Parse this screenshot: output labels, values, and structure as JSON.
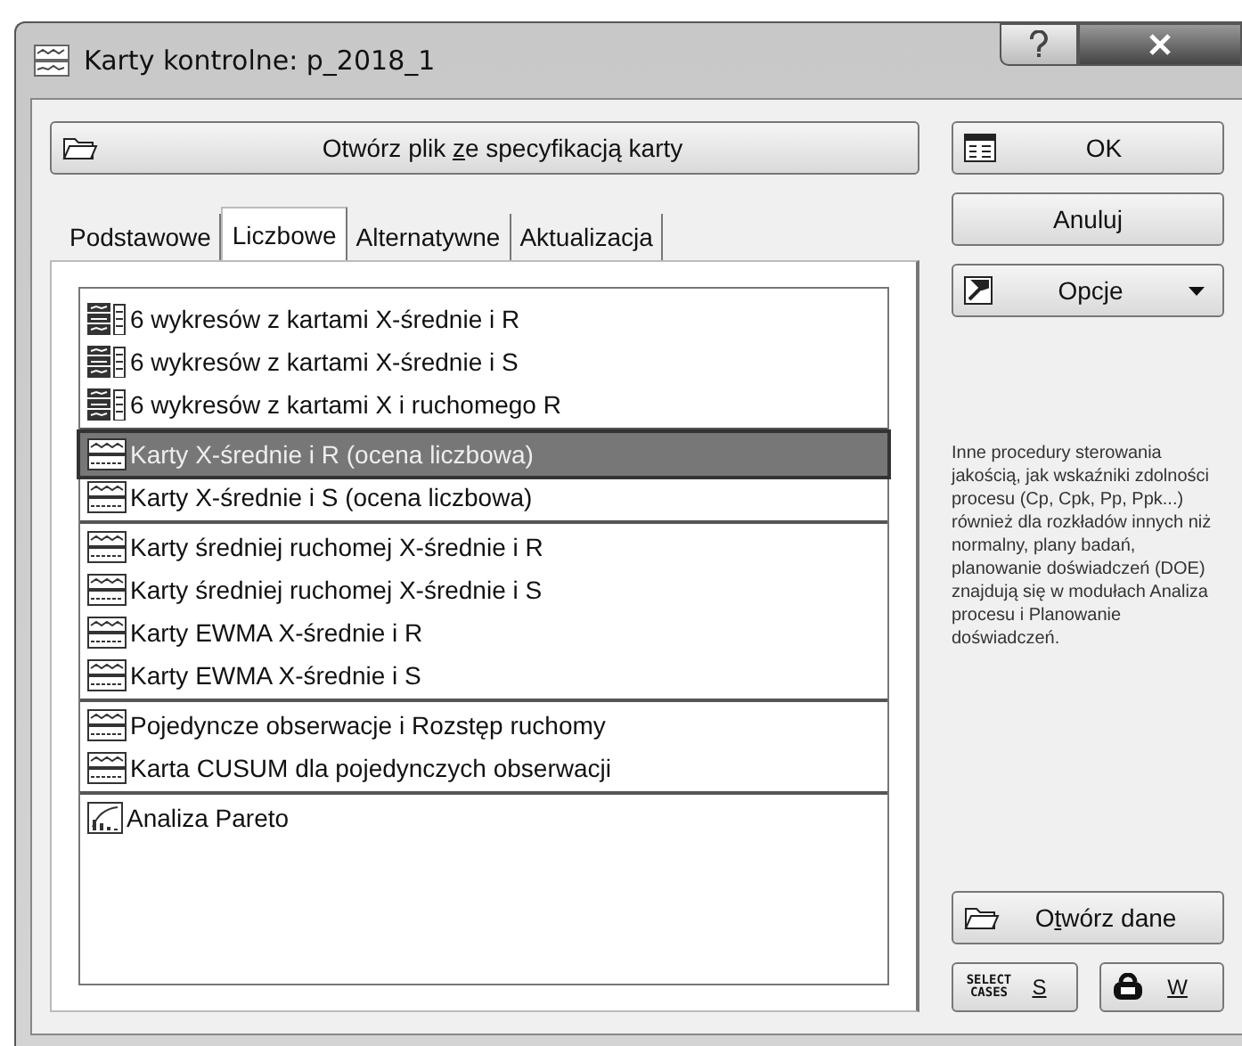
{
  "window": {
    "title": "Karty kontrolne: p_2018_1"
  },
  "open_spec_button": {
    "text_before": "Otwórz plik ",
    "key": "z",
    "text_after": "e specyfikacją karty"
  },
  "tabs": [
    {
      "label": "Podstawowe",
      "selected": false
    },
    {
      "label": "Liczbowe",
      "selected": true
    },
    {
      "label": "Alternatywne",
      "selected": false
    },
    {
      "label": "Aktualizacja",
      "selected": false
    }
  ],
  "list_groups": [
    [
      {
        "label": "6 wykresów z kartami X-średnie i R",
        "kind": "multi",
        "selected": false
      },
      {
        "label": "6 wykresów z kartami X-średnie i S",
        "kind": "multi",
        "selected": false
      },
      {
        "label": "6 wykresów z kartami X i ruchomego R",
        "kind": "multi",
        "selected": false
      }
    ],
    [
      {
        "label": "Karty X-średnie i R (ocena liczbowa)",
        "kind": "chart",
        "selected": true
      },
      {
        "label": "Karty X-średnie i S (ocena liczbowa)",
        "kind": "chart",
        "selected": false
      }
    ],
    [
      {
        "label": "Karty średniej ruchomej X-średnie i R",
        "kind": "chart",
        "selected": false
      },
      {
        "label": "Karty średniej ruchomej X-średnie i S",
        "kind": "chart",
        "selected": false
      },
      {
        "label": "Karty EWMA X-średnie i R",
        "kind": "chart",
        "selected": false
      },
      {
        "label": "Karty EWMA X-średnie i S",
        "kind": "chart",
        "selected": false
      }
    ],
    [
      {
        "label": "Pojedyncze obserwacje i Rozstęp ruchomy",
        "kind": "chart",
        "selected": false
      },
      {
        "label": "Karta CUSUM dla pojedynczych obserwacji",
        "kind": "chart",
        "selected": false
      }
    ],
    [
      {
        "label": "Analiza Pareto",
        "kind": "pareto",
        "selected": false
      }
    ]
  ],
  "ok_button": "OK",
  "cancel_button": "Anuluj",
  "options_button": "Opcje",
  "info_text": "Inne procedury sterowania jakością, jak wskaźniki zdolności procesu (Cp, Cpk, Pp, Ppk...) również dla rozkładów innych niż normalny, plany badań, planowanie doświadczeń (DOE) znajdują się w modułach Analiza procesu i Planowanie doświadczeń.",
  "open_data_button": {
    "text_before": "O",
    "key": "t",
    "text_after": "wórz dane"
  },
  "select_cases_button": {
    "icon_text": "SELECT CASES",
    "key": "S"
  },
  "weight_button": {
    "key": "W"
  }
}
